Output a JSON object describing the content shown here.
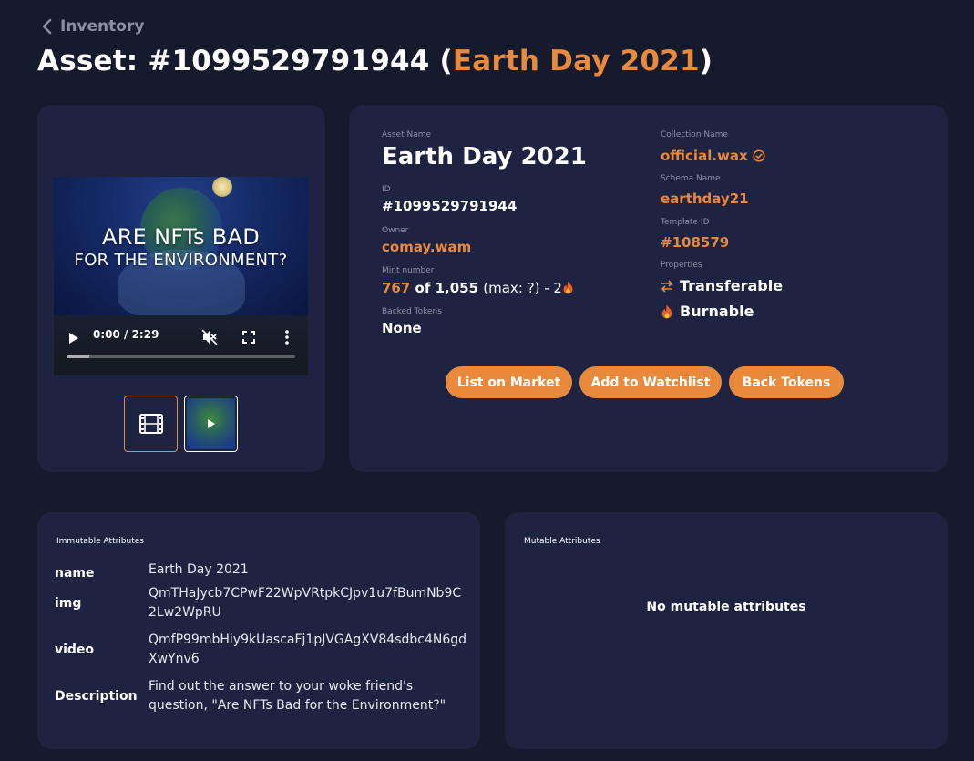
{
  "breadcrumb": {
    "back_label": "Inventory"
  },
  "title": {
    "prefix": "Asset: #1099529791944 (",
    "name": "Earth Day 2021",
    "suffix": ")"
  },
  "media": {
    "video_overlay_line1": "ARE NFTs BAD",
    "video_overlay_line2": "FOR THE ENVIRONMENT?",
    "time_display": "0:00 / 2:29",
    "progress": 0.0
  },
  "details": {
    "asset_name_label": "Asset Name",
    "asset_name": "Earth Day 2021",
    "id_label": "ID",
    "id": "#1099529791944",
    "owner_label": "Owner",
    "owner": "comay.wam",
    "mint_label": "Mint number",
    "mint_number": "767",
    "mint_of": "of 1,055",
    "mint_max": "(max: ?) - 2",
    "backed_label": "Backed Tokens",
    "backed": "None",
    "collection_label": "Collection Name",
    "collection": "official.wax",
    "schema_label": "Schema Name",
    "schema": "earthday21",
    "template_label": "Template ID",
    "template": "#108579",
    "properties_label": "Properties",
    "prop_transferable": "Transferable",
    "prop_burnable": "Burnable"
  },
  "actions": {
    "list_label": "List on Market",
    "watch_label": "Add to Watchlist",
    "back_tokens_label": "Back Tokens"
  },
  "immutable": {
    "section_label": "Immutable Attributes",
    "rows": [
      {
        "key": "name",
        "value": "Earth Day 2021"
      },
      {
        "key": "img",
        "value": "QmTHaJycb7CPwF22WpVRtpkCJpv1u7fBumNb9C2Lw2WpRU"
      },
      {
        "key": "video",
        "value": "QmfP99mbHiy9kUascaFj1pJVGAgXV84sdbc4N6gdXwYnv6"
      },
      {
        "key": "Description",
        "value": "Find out the answer to your woke friend's question, \"Are NFTs Bad for the Environment?\""
      }
    ]
  },
  "mutable": {
    "section_label": "Mutable Attributes",
    "empty_text": "No mutable attributes"
  },
  "colors": {
    "accent": "#e8893b",
    "background": "#151a2d",
    "card": "#1d2340"
  },
  "icons": [
    "chevron-left-icon",
    "play-icon",
    "mute-icon",
    "fullscreen-icon",
    "more-vertical-icon",
    "film-icon",
    "verified-icon",
    "transfer-icon",
    "fire-icon"
  ]
}
